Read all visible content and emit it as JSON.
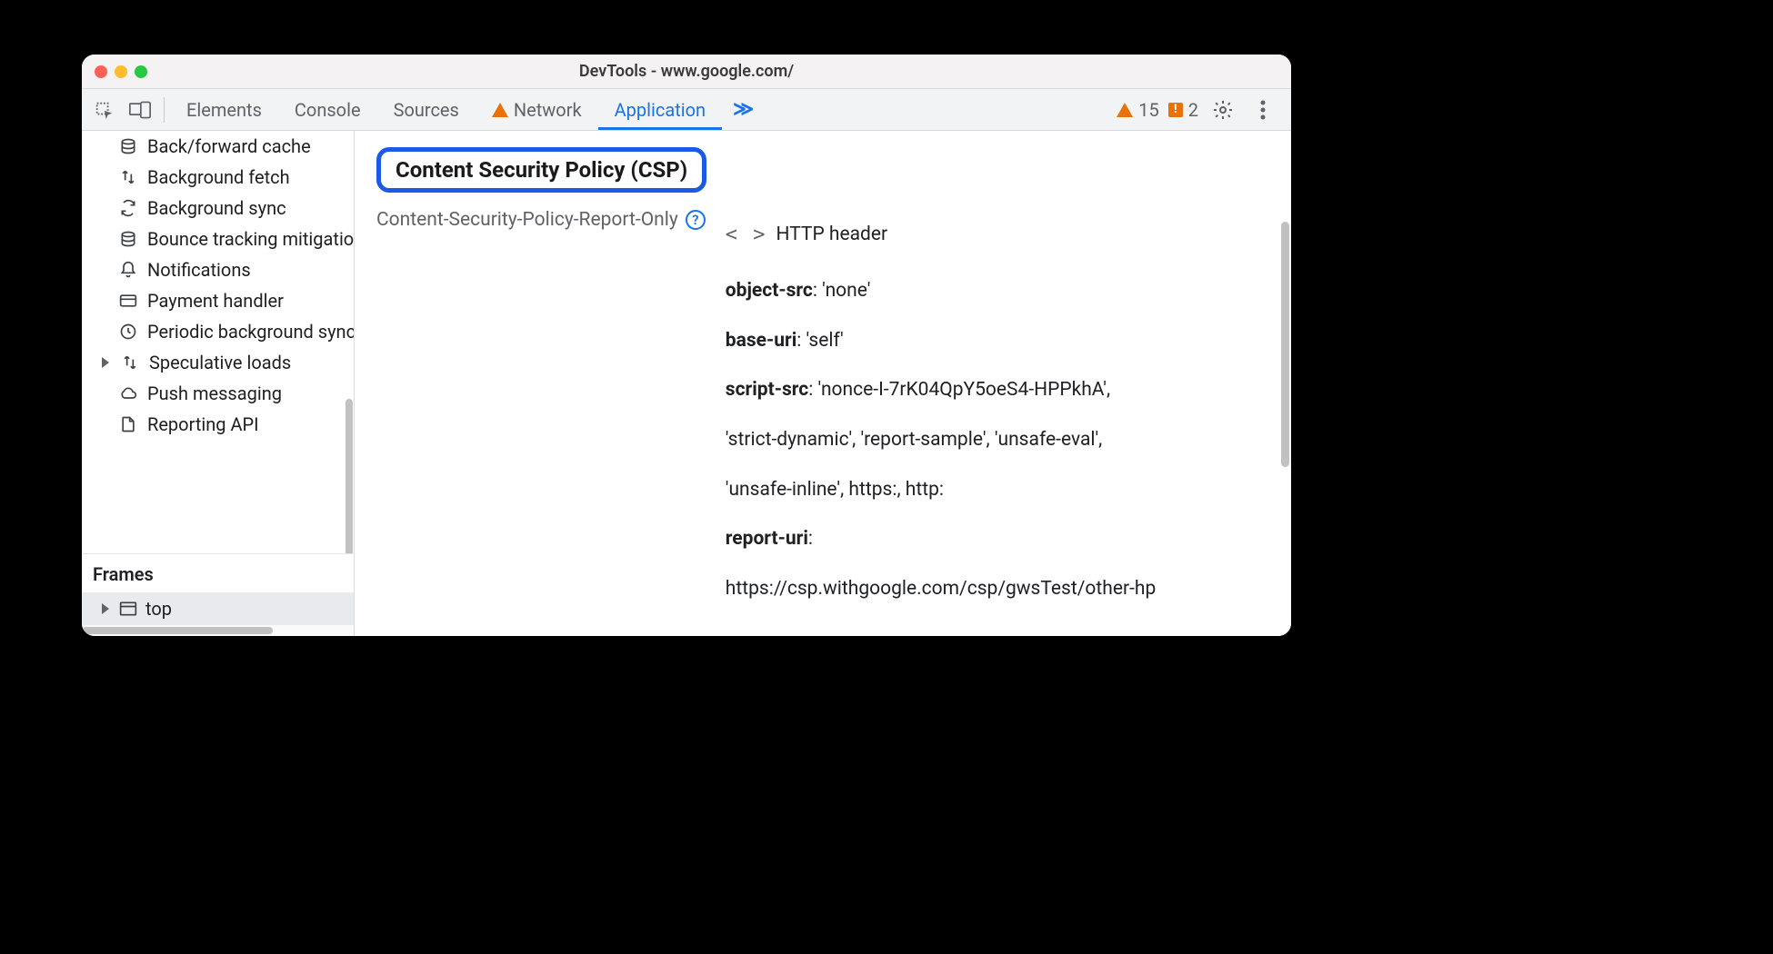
{
  "window": {
    "title": "DevTools - www.google.com/"
  },
  "toolbar": {
    "tabs": [
      {
        "label": "Elements",
        "icon": null,
        "active": false
      },
      {
        "label": "Console",
        "icon": null,
        "active": false
      },
      {
        "label": "Sources",
        "icon": null,
        "active": false
      },
      {
        "label": "Network",
        "icon": "warning",
        "active": false
      },
      {
        "label": "Application",
        "icon": null,
        "active": true
      }
    ],
    "more": "≫",
    "warnings_count": "15",
    "issues_count": "2",
    "issues_glyph": "!"
  },
  "sidebar": {
    "items": [
      {
        "icon": "database",
        "label": "Back/forward cache",
        "arrow": false
      },
      {
        "icon": "updown",
        "label": "Background fetch",
        "arrow": false
      },
      {
        "icon": "sync",
        "label": "Background sync",
        "arrow": false
      },
      {
        "icon": "database",
        "label": "Bounce tracking mitigation",
        "arrow": false
      },
      {
        "icon": "bell",
        "label": "Notifications",
        "arrow": false
      },
      {
        "icon": "card",
        "label": "Payment handler",
        "arrow": false
      },
      {
        "icon": "clock",
        "label": "Periodic background sync",
        "arrow": false
      },
      {
        "icon": "updown",
        "label": "Speculative loads",
        "arrow": true
      },
      {
        "icon": "cloud",
        "label": "Push messaging",
        "arrow": false
      },
      {
        "icon": "file",
        "label": "Reporting API",
        "arrow": false
      }
    ],
    "frames_header": "Frames",
    "frames_item": "top"
  },
  "main": {
    "section_title": "Content Security Policy (CSP)",
    "report_only_label": "Content-Security-Policy-Report-Only",
    "help_glyph": "?",
    "source_label": "HTTP header",
    "directives": [
      {
        "key": "object-src",
        "value": ": 'none'"
      },
      {
        "key": "base-uri",
        "value": ": 'self'"
      },
      {
        "key": "script-src",
        "value": ": 'nonce-I-7rK04QpY5oeS4-HPPkhA',"
      },
      {
        "key": "",
        "value": "'strict-dynamic', 'report-sample', 'unsafe-eval',"
      },
      {
        "key": "",
        "value": "'unsafe-inline', https:, http:"
      },
      {
        "key": "report-uri",
        "value": ":"
      },
      {
        "key": "",
        "value": "https://csp.withgoogle.com/csp/gwsTest/other-hp"
      }
    ]
  }
}
